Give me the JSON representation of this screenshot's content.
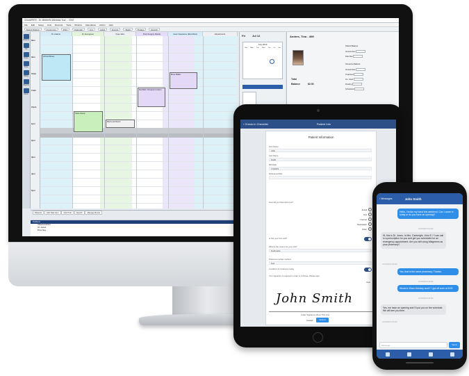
{
  "imac": {
    "title_bar": "ChiroWRITE - Dr. Mitchell's Windows Tour ... 2015",
    "menu": [
      "File",
      "Edit",
      "Setup",
      "Lists",
      "Records",
      "Tools",
      "Window",
      "Attendance",
      "Admin",
      "Help"
    ],
    "toolbar": [
      "Select Patient",
      "Customize",
      "Print",
      "Calendar",
      "Cut",
      "Label",
      "Events",
      "Tasks",
      "Todays",
      "Search"
    ],
    "sidebar": [
      "Patients",
      "Cal",
      "Notes",
      "Docs",
      "Billing",
      "Reports",
      "Admin"
    ],
    "columns": [
      "Dr. Adams",
      "Dr. Evergreen",
      "Yoga Jabs",
      "Post-Surgery Rehab",
      "Gear Clearance (Mon/Wed)",
      "Adjustments"
    ],
    "times": [
      "8am",
      "9am",
      "10am",
      "11am",
      "12pm",
      "1pm",
      "2pm",
      "3pm",
      "4pm",
      "5pm"
    ],
    "appointments": [
      "Jeff and Renee",
      "Mud Bath. Chiropract Ut Ahem",
      "Bruce Walker",
      "Helen Jovens",
      "Mad Lunch Bunch"
    ],
    "mini_cal": {
      "date_label": "Fri",
      "date": "Jul 12",
      "month": "July 2019",
      "weekdays": [
        "Sun",
        "Mon",
        "Tue",
        "Wed",
        "Thu",
        "Fri",
        "Sat"
      ]
    },
    "patient": {
      "name": "Anders, Tina - 40ft",
      "labels": [
        "Patient Balance",
        "Amount Due",
        "Past Due",
        "Insurance Balance",
        "Amount Due",
        "Treatment",
        "Ins. Used",
        "Pending",
        "Scheduled"
      ],
      "stats": [
        "Total",
        "Balance",
        "$2.00"
      ]
    },
    "bottom_tabs": [
      "Patients",
      "Add Task Item",
      "Add Prob",
      "Search",
      "Manage Books"
    ],
    "bottom_list_header": "Problems",
    "bottom_rows": [
      "Ultrasound/vibro",
      "Sh. default",
      "Brow Tape"
    ]
  },
  "ipad": {
    "back": "Check-In Checklist",
    "nav_title": "Patient Info",
    "form_title": "Patient Information",
    "fields": [
      {
        "label": "First Name",
        "value": "John"
      },
      {
        "label": "Last Name",
        "value": "Smith"
      },
      {
        "label": "Birthdate",
        "value": "7/1/1979"
      },
      {
        "label": "Nickname/Alias",
        "value": ""
      }
    ],
    "question_heard": "How did you hear about us?",
    "options": [
      "Email",
      "Text",
      "Internet",
      "Newspaper",
      "Other"
    ],
    "toggle_label": "Is this your first visit?",
    "reason_label": "What is the reason for your visit?",
    "reason_value": "Tooth ache",
    "consent_label": "Preferred contact method",
    "consent_value": "Text",
    "cond_label": "Condition for treatment today",
    "sig_label": "Your signature is required in order to continue. Please sign:",
    "sig_clear": "clear",
    "signature": "John Smith",
    "sig_caption": "Under Signature Above This Line",
    "buttons": [
      "Cancel",
      "Submit"
    ]
  },
  "iphone": {
    "back": "Messages",
    "contact": "John Smith",
    "messages": [
      {
        "dir": "in",
        "text": "Hello, I broke my hand this weekend. Can I come in today or do you have an opening?"
      },
      {
        "dir": "out",
        "text": "Hi, this is Dr. Jones. Is Mrs. Cartwright, John E.? I can call in a prescription for you and get you scheduled for an emergency appointment. Are you still using Walgreens as your pharmacy?"
      },
      {
        "dir": "in",
        "text": "Yes, that is the same pharmacy. Thanks."
      },
      {
        "dir": "in",
        "text": "Would a 10am Monday work? I got off work at 8:00"
      },
      {
        "dir": "out",
        "text": "Yes, we have an opening and I'll put you on the schedule. We will see you then."
      }
    ],
    "stamps": [
      "10/13/2019 9:02 AM",
      "10/13/2019 9:15 AM",
      "10/13/2019 9:20 AM",
      "10/13/2019 9:32 AM",
      "10/13/2019 9:40 AM"
    ],
    "input_placeholder": "Message...",
    "send": "Send"
  }
}
